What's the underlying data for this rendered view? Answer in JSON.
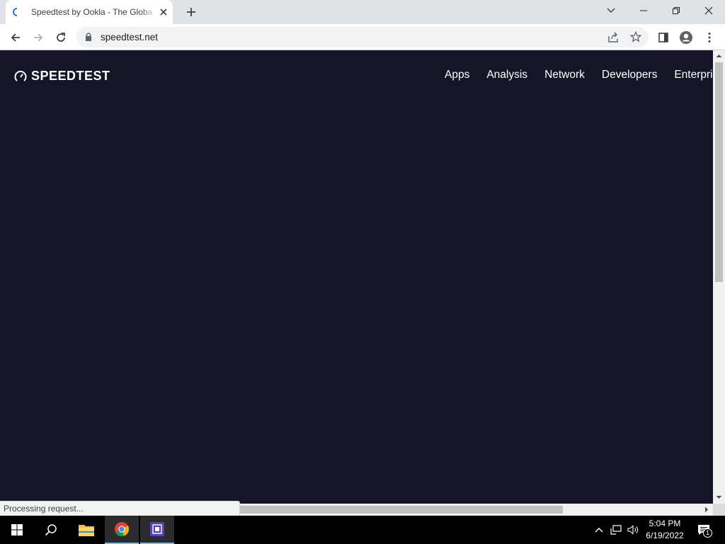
{
  "browser": {
    "tab_title": "Speedtest by Ookla - The Global Broadband Speed Test",
    "url": "speedtest.net",
    "status_text": "Processing request..."
  },
  "page": {
    "logo_text": "SPEEDTEST",
    "nav": [
      "Apps",
      "Analysis",
      "Network",
      "Developers",
      "Enterprise"
    ],
    "colors": {
      "background": "#141526",
      "text": "#ffffff"
    }
  },
  "taskbar": {
    "time": "5:04 PM",
    "date": "6/19/2022",
    "notification_count": "1",
    "apps": [
      "start-icon",
      "search-icon",
      "file-explorer-icon",
      "chrome-icon",
      "app-icon"
    ]
  }
}
